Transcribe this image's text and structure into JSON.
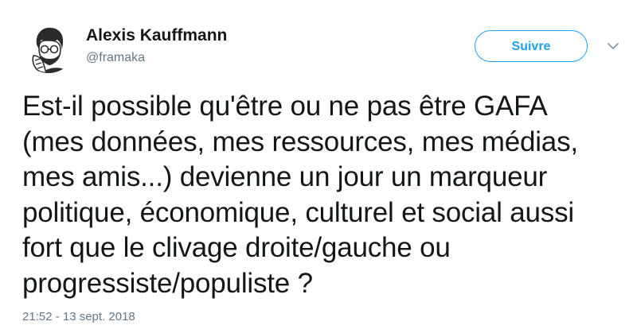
{
  "author": {
    "name": "Alexis Kauffmann",
    "handle": "@framaka"
  },
  "follow_button": {
    "label": "Suivre"
  },
  "menu": {
    "icon": "chevron-down-icon"
  },
  "tweet": {
    "lines": [
      "Est-il possible qu'être ou ne pas être GAFA",
      "(mes données, mes ressources, mes médias,",
      "mes amis...) devienne un jour un marqueur",
      "politique, économique, culturel et social aussi",
      "fort que le clivage droite/gauche ou",
      "progressiste/populiste ?"
    ],
    "timestamp": "21:52 - 13 sept. 2018"
  },
  "colors": {
    "accent": "#1da1f2",
    "text": "#14171a",
    "muted": "#657786"
  }
}
